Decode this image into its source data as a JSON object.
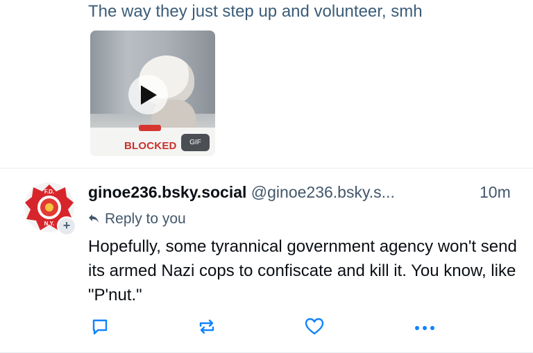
{
  "previous_post": {
    "text": "The way they just step up and volunteer, smh",
    "gif": {
      "overlay_text": "BLOCKED",
      "badge": "GIF"
    }
  },
  "post": {
    "display_name": "ginoe236.bsky.social",
    "handle": "@ginoe236.bsky.s...",
    "time": "10m",
    "reply_label": "Reply to you",
    "text": "Hopefully, some tyrannical government agency won't send its armed Nazi cops to confiscate and kill it. You know, like \"P'nut.\"",
    "avatar": {
      "top_text": "F.D.",
      "bottom_text": "N.Y."
    }
  },
  "colors": {
    "accent": "#1083fe",
    "muted": "#42576b",
    "text": "#0b0f14"
  },
  "icons": [
    "play-icon",
    "reply-arrow-icon",
    "comment-icon",
    "repost-icon",
    "like-icon",
    "more-icon",
    "plus-icon"
  ]
}
